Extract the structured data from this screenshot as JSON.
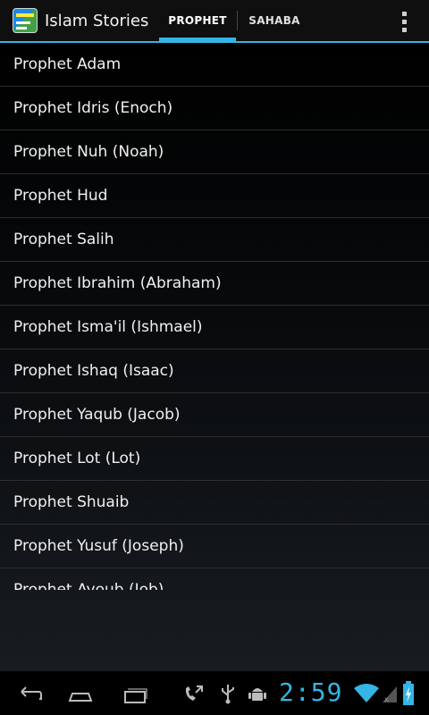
{
  "app": {
    "title": "Islam Stories"
  },
  "tabs": [
    {
      "label": "PROPHET",
      "selected": true
    },
    {
      "label": "SAHABA",
      "selected": false
    }
  ],
  "list": {
    "items": [
      "Prophet Adam",
      "Prophet Idris (Enoch)",
      "Prophet Nuh (Noah)",
      "Prophet Hud",
      "Prophet Salih",
      "Prophet Ibrahim (Abraham)",
      "Prophet Isma'il (Ishmael)",
      "Prophet Ishaq (Isaac)",
      "Prophet Yaqub (Jacob)",
      "Prophet Lot (Lot)",
      "Prophet Shuaib",
      "Prophet Yusuf (Joseph)",
      "Prophet Ayoub (Job)"
    ]
  },
  "status": {
    "time": "2:59",
    "icons": [
      "call-forward-icon",
      "usb-icon",
      "android-debug-icon",
      "wifi-icon",
      "signal-icon",
      "battery-charging-icon"
    ]
  },
  "colors": {
    "accent": "#33b5e5",
    "background": "#000000"
  }
}
